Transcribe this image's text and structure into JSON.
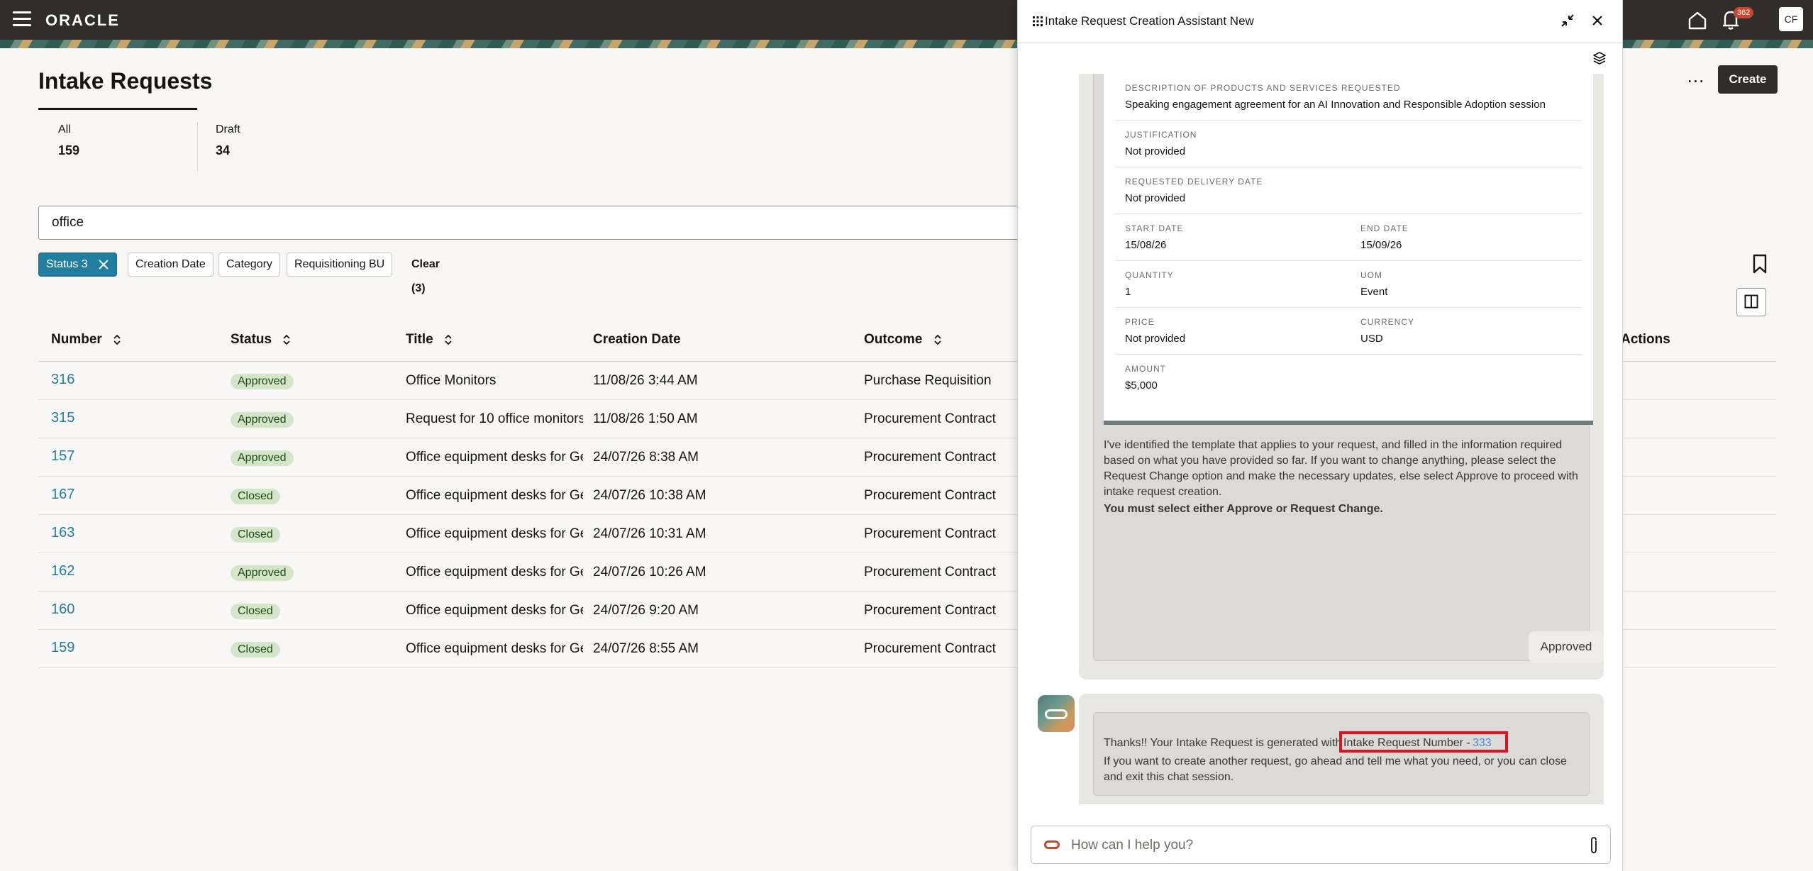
{
  "topbar": {
    "logo": "ORACLE",
    "notification_count": "362",
    "user_initials": "CF"
  },
  "page": {
    "title": "Intake Requests",
    "counts": [
      {
        "label": "All",
        "value": "159"
      },
      {
        "label": "Draft",
        "value": "34"
      }
    ],
    "search_value": "office",
    "filters": {
      "status_chip": "Status 3",
      "creation_date": "Creation Date",
      "category": "Category",
      "requisitioning_bu": "Requisitioning BU",
      "clear": "Clear (3)"
    },
    "create_label": "Create",
    "more_label": "...",
    "actions_header": "Actions"
  },
  "table": {
    "headers": {
      "number": "Number",
      "status": "Status",
      "title": "Title",
      "creation_date": "Creation Date",
      "outcome": "Outcome"
    },
    "rows": [
      {
        "number": "316",
        "status": "Approved",
        "title": "Office Monitors",
        "date": "11/08/26 3:44 AM",
        "outcome": "Purchase Requisition"
      },
      {
        "number": "315",
        "status": "Approved",
        "title": "Request for 10 office monitors",
        "date": "11/08/26 1:50 AM",
        "outcome": "Procurement Contract"
      },
      {
        "number": "157",
        "status": "Approved",
        "title": "Office equipment desks for Ge",
        "date": "24/07/26 8:38 AM",
        "outcome": "Procurement Contract"
      },
      {
        "number": "167",
        "status": "Closed",
        "title": "Office equipment desks for Ge",
        "date": "24/07/26 10:38 AM",
        "outcome": "Procurement Contract"
      },
      {
        "number": "163",
        "status": "Closed",
        "title": "Office equipment desks for Ge",
        "date": "24/07/26 10:31 AM",
        "outcome": "Procurement Contract"
      },
      {
        "number": "162",
        "status": "Approved",
        "title": "Office equipment desks for Ge",
        "date": "24/07/26 10:26 AM",
        "outcome": "Procurement Contract"
      },
      {
        "number": "160",
        "status": "Closed",
        "title": "Office equipment desks for Ge",
        "date": "24/07/26 9:20 AM",
        "outcome": "Procurement Contract"
      },
      {
        "number": "159",
        "status": "Closed",
        "title": "Office equipment desks for Ge",
        "date": "24/07/26 8:55 AM",
        "outcome": "Procurement Contract"
      }
    ]
  },
  "assistant": {
    "title": "Intake Request Creation Assistant New",
    "form": {
      "description_label": "DESCRIPTION OF PRODUCTS AND SERVICES REQUESTED",
      "description_value": "Speaking engagement agreement for an AI Innovation and Responsible Adoption session",
      "justification_label": "JUSTIFICATION",
      "justification_value": "Not provided",
      "delivery_label": "REQUESTED DELIVERY DATE",
      "delivery_value": "Not provided",
      "start_label": "START DATE",
      "start_value": "15/08/26",
      "end_label": "END DATE",
      "end_value": "15/09/26",
      "quantity_label": "QUANTITY",
      "quantity_value": "1",
      "uom_label": "UOM",
      "uom_value": "Event",
      "price_label": "PRICE",
      "price_value": "Not provided",
      "currency_label": "CURRENCY",
      "currency_value": "USD",
      "amount_label": "AMOUNT",
      "amount_value": "$5,000"
    },
    "bot_message": "I've identified the template that applies to your request, and filled in the information required based on what you have provided so far. If you want to change anything, please select the Request Change option and make the necessary updates, else select Approve to proceed with intake request creation.",
    "bot_bold": "You must select either Approve or Request Change.",
    "user_reply": "Approved",
    "thanks_prefix": "Thanks!! Your Intake Request is generated with",
    "ir_label": "Intake Request Number -",
    "ir_number": "333",
    "thanks_line2": "If you want to create another request, go ahead and tell me what you need, or you can close and exit this chat session.",
    "input_placeholder": "How can I help you?"
  }
}
